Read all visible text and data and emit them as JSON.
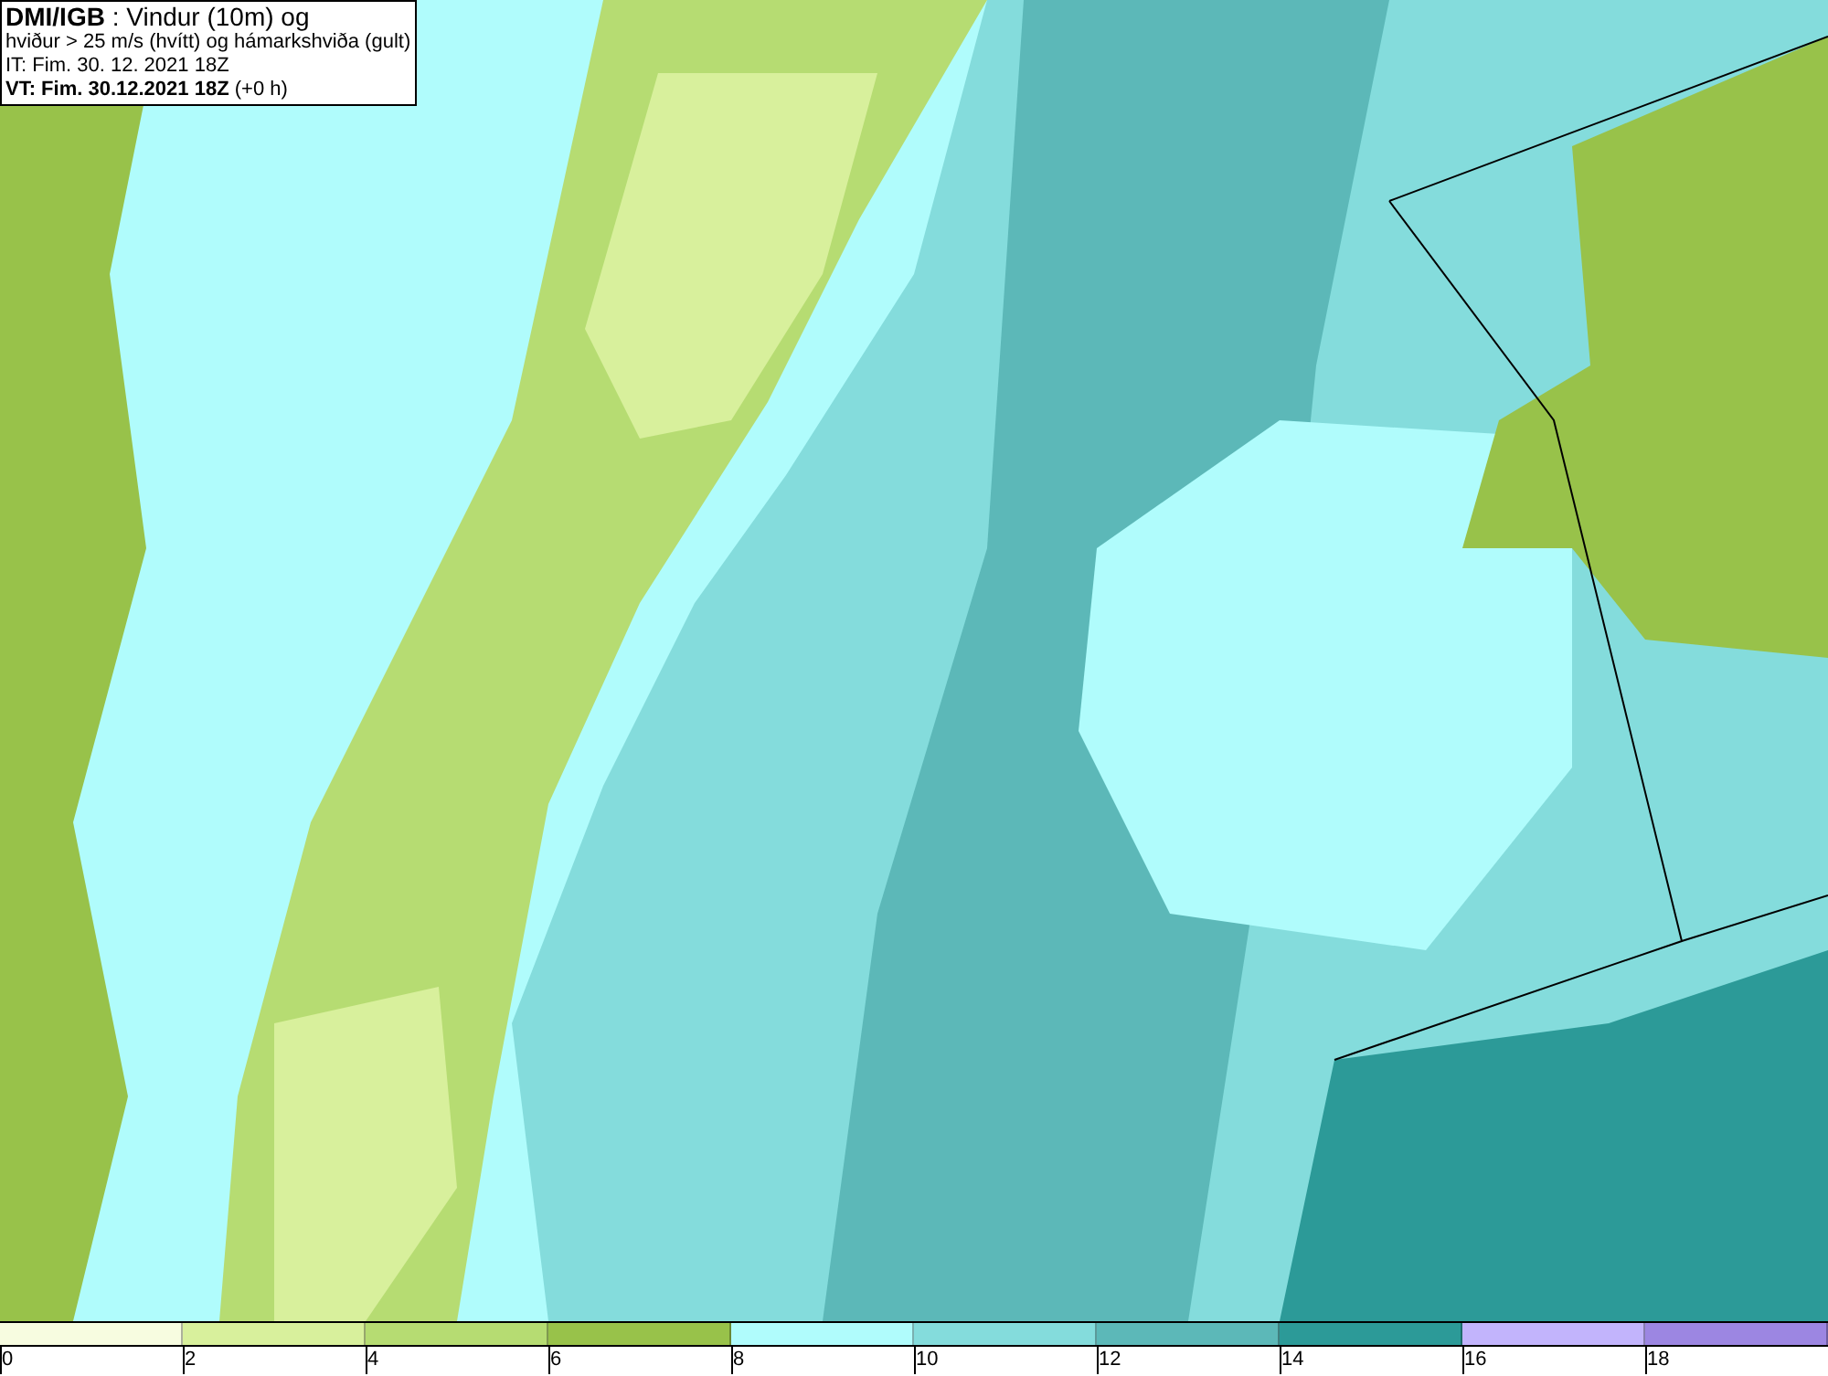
{
  "title_box": {
    "lines": [
      "**DMI/IGB** : Vindur (10m) og",
      "hviður > 25 m/s (hvítt) og hámarkshviða (gult)",
      "IT: Fim. 30. 12. 2021 18Z",
      "**VT: Fim. 30.12.2021 18Z** (+0 h)"
    ]
  },
  "legend": {
    "bins": [
      {
        "color": "#f7fce0"
      },
      {
        "color": "#d8f09c"
      },
      {
        "color": "#b6dc72"
      },
      {
        "color": "#98c24a"
      },
      {
        "color": "#b0fcfc"
      },
      {
        "color": "#84dcdc"
      },
      {
        "color": "#5cb8b8"
      },
      {
        "color": "#2c9a98"
      },
      {
        "color": "#c2b4fc"
      },
      {
        "color": "#9c86e2"
      }
    ],
    "ticks": [
      "0",
      "2",
      "4",
      "6",
      "8",
      "10",
      "12",
      "14",
      "16",
      "18"
    ]
  }
}
